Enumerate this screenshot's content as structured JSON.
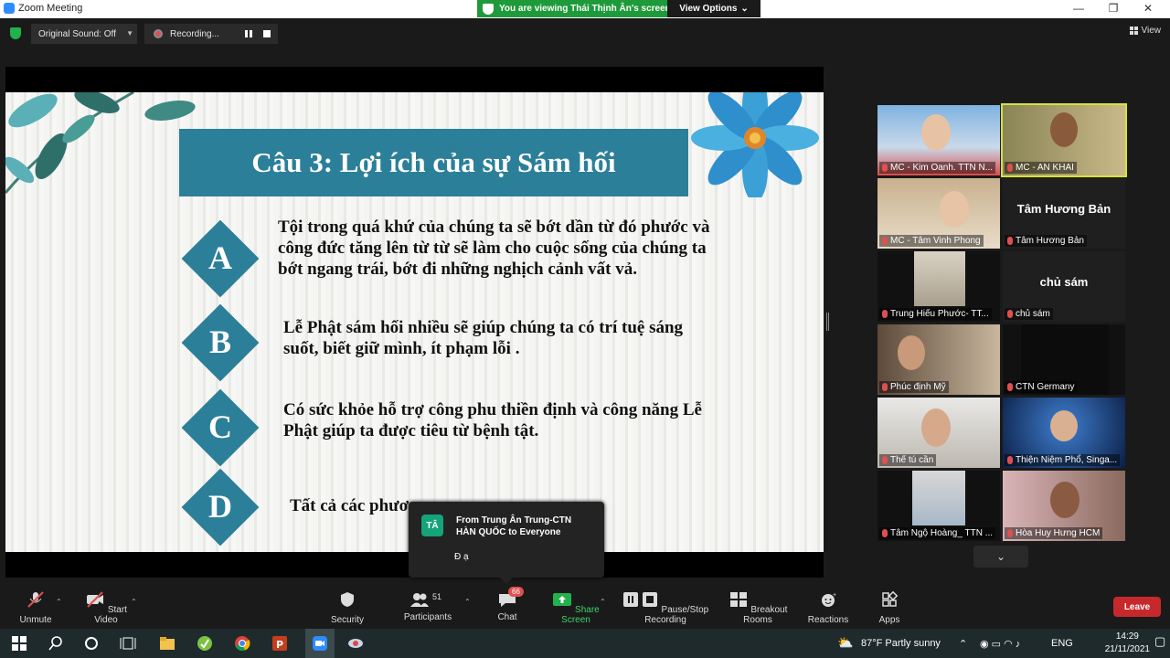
{
  "window": {
    "title": "Zoom Meeting"
  },
  "share_banner": {
    "text": "You are viewing Thái Thịnh Ân's screen",
    "options": "View Options"
  },
  "top_controls": {
    "original_sound": "Original Sound: Off",
    "recording": "Recording..."
  },
  "view": {
    "label": "View"
  },
  "slide": {
    "title": "Câu 3: Lợi ích của sự Sám hối",
    "answers": [
      {
        "letter": "A",
        "text": "Tội trong quá khứ của chúng ta sẽ bớt dần từ đó phước và công đức tăng lên từ từ sẽ làm cho cuộc sống của chúng ta bớt ngang trái, bớt đi những nghịch cảnh vất vả."
      },
      {
        "letter": "B",
        "text": "Lễ Phật sám hối nhiều sẽ giúp chúng ta có trí tuệ sáng suốt, biết giữ mình, ít phạm lỗi ."
      },
      {
        "letter": "C",
        "text": "Có sức khỏe hỗ trợ công phu thiền định và công năng Lễ Phật giúp ta được tiêu từ bệnh tật."
      },
      {
        "letter": "D",
        "text": "Tất cả các phươ"
      }
    ]
  },
  "participants": [
    {
      "name": "MC - Kim Oanh. TTN N..."
    },
    {
      "name": "MC - AN KHAI"
    },
    {
      "name": "MC - Tâm Vinh Phong"
    },
    {
      "name": "Tâm Hương Bản",
      "big": "Tâm Hương Bản"
    },
    {
      "name": "Trung Hiếu Phước- TT..."
    },
    {
      "name": "chủ sám",
      "big": "chủ sám"
    },
    {
      "name": "Phúc định Mỹ"
    },
    {
      "name": "CTN Germany"
    },
    {
      "name": "Thế tú cần"
    },
    {
      "name": "Thiện Niệm Phổ, Singa..."
    },
    {
      "name": "Tâm Ngộ Hoàng_ TTN ..."
    },
    {
      "name": "Hòa Huy Hưng HCM"
    }
  ],
  "chat_popup": {
    "avatar": "TÂ",
    "from": "From Trung Ân Trung-CTN HÀN QUỐC to Everyone",
    "message": "Đ ạ"
  },
  "toolbar": {
    "unmute": "Unmute",
    "start_video": "Start Video",
    "security": "Security",
    "participants": "Participants",
    "participant_count": "51",
    "chat": "Chat",
    "chat_badge": "66",
    "share_screen": "Share Screen",
    "pause_stop": "Pause/Stop Recording",
    "breakout": "Breakout Rooms",
    "reactions": "Reactions",
    "apps": "Apps",
    "leave": "Leave"
  },
  "taskbar": {
    "weather": "87°F  Partly sunny",
    "lang": "ENG",
    "time": "14:29",
    "date": "21/11/2021"
  },
  "colors": {
    "accent": "#2c7f99",
    "banner": "#1f9a3a",
    "leave": "#c7282c"
  }
}
